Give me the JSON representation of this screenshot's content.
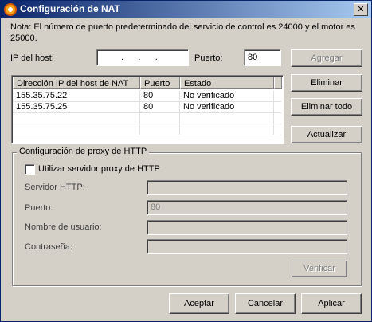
{
  "window": {
    "title": "Configuración de NAT",
    "close_glyph": "✕"
  },
  "note": "Nota: El número de puerto predeterminado del servicio de control es 24000 y el motor es 25000.",
  "host": {
    "ip_label": "IP del host:",
    "ip_value": ".      .      .",
    "port_label": "Puerto:",
    "port_value": "80"
  },
  "buttons": {
    "add": "Agregar",
    "remove": "Eliminar",
    "remove_all": "Eliminar todo",
    "refresh": "Actualizar",
    "verify": "Verificar",
    "accept": "Aceptar",
    "cancel": "Cancelar",
    "apply": "Aplicar"
  },
  "table": {
    "headers": [
      "Dirección IP del host de NAT",
      "Puerto",
      "Estado"
    ],
    "rows": [
      [
        "155.35.75.22",
        "80",
        "No verificado"
      ],
      [
        "155.35.75.25",
        "80",
        "No verificado"
      ]
    ]
  },
  "proxy": {
    "group_title": "Configuración de proxy de HTTP",
    "use_proxy_label": "Utilizar servidor proxy de HTTP",
    "use_proxy_checked": false,
    "server_label": "Servidor HTTP:",
    "server_value": "",
    "port_label": "Puerto:",
    "port_value": "80",
    "user_label": "Nombre de usuario:",
    "user_value": "",
    "password_label": "Contraseña:",
    "password_value": ""
  }
}
